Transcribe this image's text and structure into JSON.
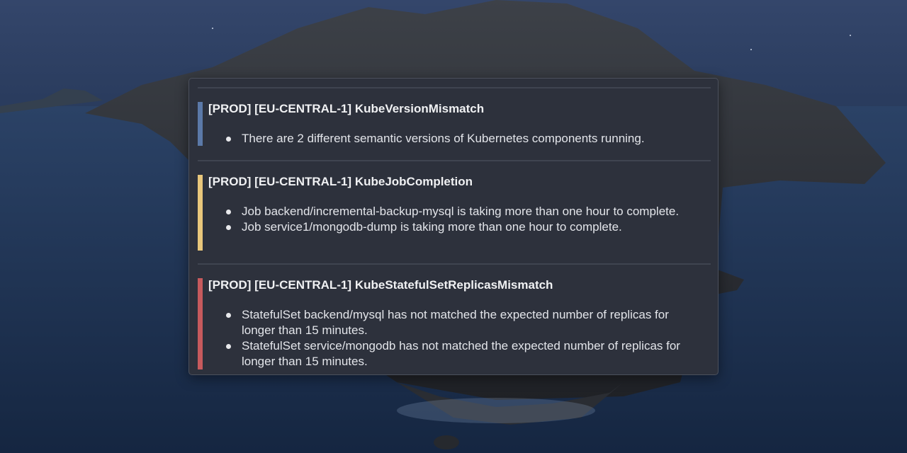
{
  "alerts": [
    {
      "title": "[PROD] [EU-CENTRAL-1] KubeVersionMismatch",
      "color": "#5b79a8",
      "severity": "info",
      "items": [
        "There are 2 different semantic versions of Kubernetes components running."
      ]
    },
    {
      "title": "[PROD] [EU-CENTRAL-1] KubeJobCompletion",
      "color": "#e9c77b",
      "severity": "warning",
      "items": [
        "Job backend/incremental-backup-mysql is taking more than one hour to complete.",
        "Job service1/mongodb-dump is taking more than one hour to complete."
      ]
    },
    {
      "title": "[PROD] [EU-CENTRAL-1] KubeStatefulSetReplicasMismatch",
      "color": "#c75a5d",
      "severity": "critical",
      "items": [
        "StatefulSet backend/mysql has not matched the expected number of replicas for longer than 15 minutes.",
        "StatefulSet service/mongodb has not matched the expected number of replicas for longer than 15 minutes."
      ]
    }
  ]
}
